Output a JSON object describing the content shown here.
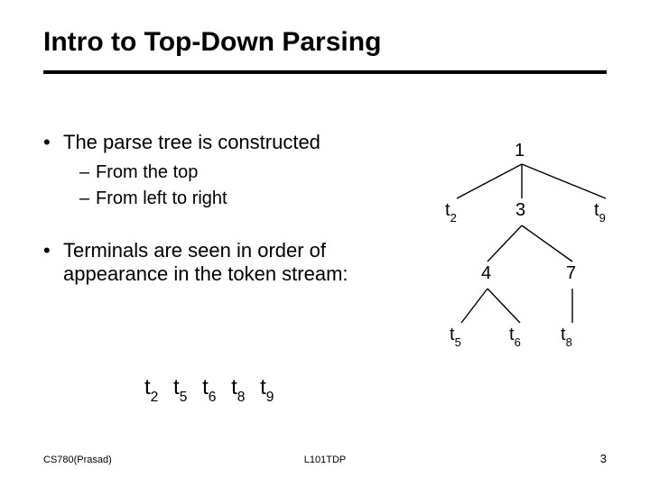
{
  "title": "Intro to Top-Down Parsing",
  "bullets": {
    "main1": "The parse tree is constructed",
    "sub1a": "From the top",
    "sub1b": "From left to right",
    "main2": "Terminals are seen in order of appearance in the token stream:"
  },
  "token_sequence": {
    "t2": {
      "base": "t",
      "sub": "2"
    },
    "t5": {
      "base": "t",
      "sub": "5"
    },
    "t6": {
      "base": "t",
      "sub": "6"
    },
    "t8": {
      "base": "t",
      "sub": "8"
    },
    "t9": {
      "base": "t",
      "sub": "9"
    }
  },
  "tree": {
    "n1": "1",
    "n_t2": {
      "base": "t",
      "sub": "2"
    },
    "n3": "3",
    "n_t9": {
      "base": "t",
      "sub": "9"
    },
    "n4": "4",
    "n7": "7",
    "n_t5": {
      "base": "t",
      "sub": "5"
    },
    "n_t6": {
      "base": "t",
      "sub": "6"
    },
    "n_t8": {
      "base": "t",
      "sub": "8"
    }
  },
  "footer": {
    "left": "CS780(Prasad)",
    "center": "L101TDP",
    "right": "3"
  },
  "chart_data": {
    "type": "tree",
    "title": "Intro to Top-Down Parsing",
    "nodes": [
      "1",
      "t2",
      "3",
      "t9",
      "4",
      "7",
      "t5",
      "t6",
      "t8"
    ],
    "edges": [
      [
        "1",
        "t2"
      ],
      [
        "1",
        "3"
      ],
      [
        "1",
        "t9"
      ],
      [
        "3",
        "4"
      ],
      [
        "3",
        "7"
      ],
      [
        "4",
        "t5"
      ],
      [
        "4",
        "t6"
      ],
      [
        "7",
        "t8"
      ]
    ],
    "terminal_order": [
      "t2",
      "t5",
      "t6",
      "t8",
      "t9"
    ]
  }
}
